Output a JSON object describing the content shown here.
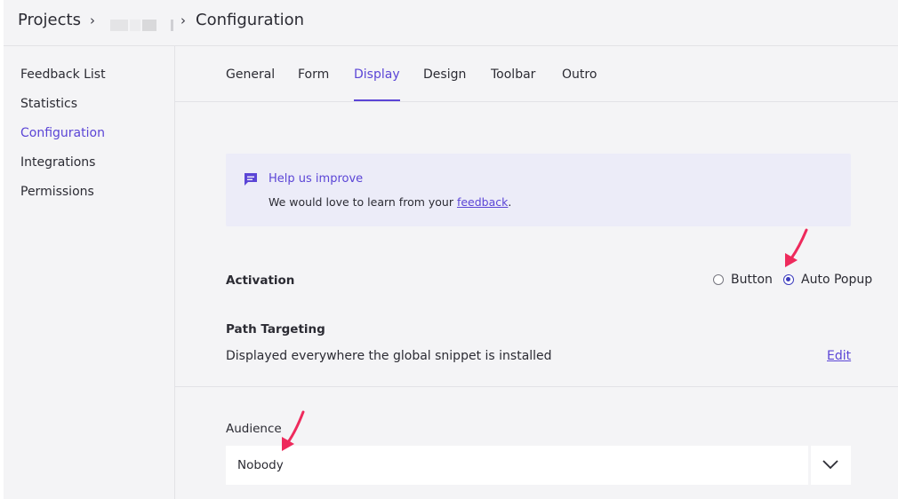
{
  "breadcrumb": {
    "projects": "Projects",
    "sep1": "›",
    "sep2": "›",
    "current": "Configuration"
  },
  "sidebar": {
    "items": [
      {
        "label": "Feedback List"
      },
      {
        "label": "Statistics"
      },
      {
        "label": "Configuration"
      },
      {
        "label": "Integrations"
      },
      {
        "label": "Permissions"
      }
    ],
    "active_item": "Configuration"
  },
  "tabs": [
    {
      "label": "General"
    },
    {
      "label": "Form"
    },
    {
      "label": "Display"
    },
    {
      "label": "Design"
    },
    {
      "label": "Toolbar"
    },
    {
      "label": "Outro"
    }
  ],
  "active_tab": "Display",
  "banner": {
    "title": "Help us improve",
    "text_before": "We would love to learn from your",
    "link": "feedback",
    "text_after": ".",
    "icon": "chat-icon"
  },
  "activation": {
    "label": "Activation",
    "options": [
      {
        "label": "Button",
        "selected": false
      },
      {
        "label": "Auto Popup",
        "selected": true
      }
    ]
  },
  "path_targeting": {
    "label": "Path Targeting",
    "description": "Displayed everywhere the global snippet is installed",
    "edit": "Edit"
  },
  "audience": {
    "label": "Audience",
    "value": "Nobody"
  },
  "colors": {
    "accent": "#5b45d6",
    "annotation_arrow": "#ee2a5c",
    "radio_selected": "#3b3bbd"
  }
}
